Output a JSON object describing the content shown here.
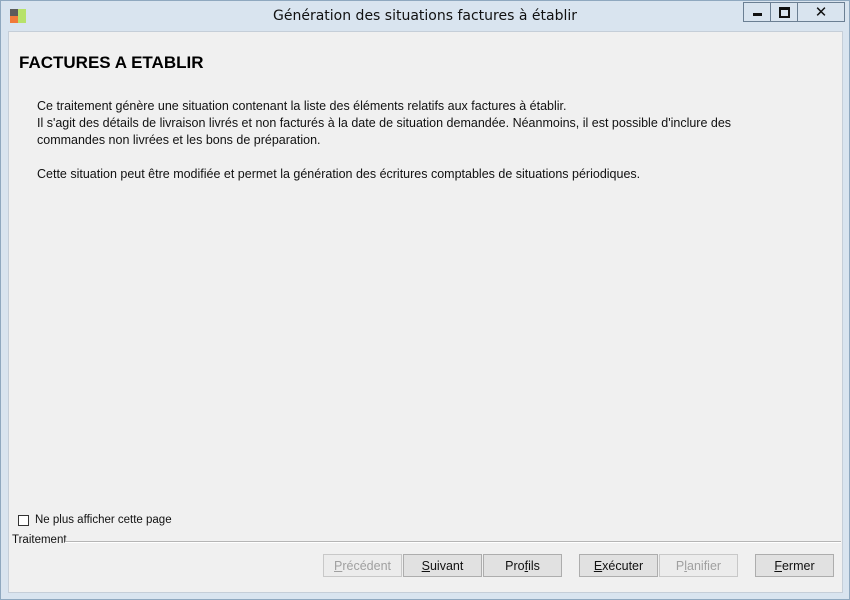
{
  "window": {
    "title": "Génération des situations factures à établir",
    "icon": "app-logo-icon"
  },
  "page": {
    "heading": "FACTURES A ETABLIR",
    "paragraph1_line1": "Ce traitement génère une situation contenant la liste des éléments relatifs aux factures à établir.",
    "paragraph1_line2": "Il s'agit des détails de livraison livrés et non facturés à la date de situation demandée. Néanmoins, il est possible d'inclure des commandes non livrées et les bons de préparation.",
    "paragraph2": "Cette situation peut être modifiée et permet la génération des écritures comptables de situations périodiques."
  },
  "options": {
    "dont_show_label": "Ne plus afficher cette page",
    "dont_show_checked": false
  },
  "footer": {
    "group_label": "Traitement",
    "buttons": {
      "previous": {
        "label": "Précédent",
        "mnemonic": "P",
        "rest": "récédent",
        "enabled": false
      },
      "next": {
        "label": "Suivant",
        "mnemonic": "S",
        "rest": "uivant",
        "enabled": true
      },
      "profiles": {
        "pre": "Pro",
        "mnemonic": "f",
        "rest": "ils",
        "label": "Profils",
        "enabled": true
      },
      "execute": {
        "mnemonic": "E",
        "rest": "xécuter",
        "label": "Exécuter",
        "enabled": true
      },
      "schedule": {
        "pre": "P",
        "mnemonic": "l",
        "rest": "anifier",
        "label": "Planifier",
        "enabled": false
      },
      "close": {
        "mnemonic": "F",
        "rest": "ermer",
        "label": "Fermer",
        "enabled": true
      }
    }
  }
}
